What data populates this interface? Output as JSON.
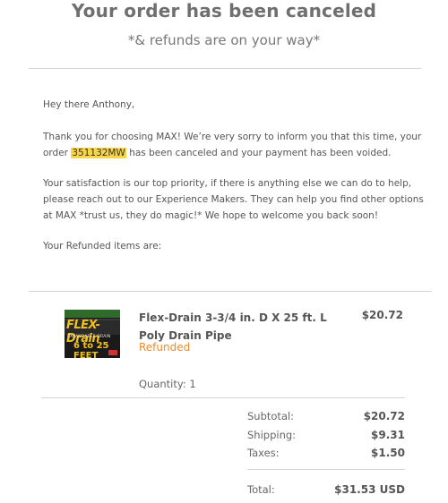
{
  "header": {
    "title": "Your order has been canceled",
    "subtitle": "*& refunds are on your way*"
  },
  "message": {
    "greeting": "Hey there Anthony,",
    "para1_before": "Thank you for choosing MAX! We’re very sorry to inform you that this time, your order ",
    "order_number": "351132MW",
    "para1_after": " has been canceled and your payment has been voided.",
    "para2": "Your satisfaction is our top priority, if there is anything else we can do to help, please reach out to our Experience Makers. They can help you find other options at MAX *trust us, they do magic!* We hope to welcome you back soon!",
    "refunded_intro": "Your Refunded items are:"
  },
  "item": {
    "image_brand_text": "FLEX-Drain",
    "image_sub_text": "EXPANDABLE DRAIN",
    "image_size_text": "6 to 25 FEET",
    "name": "Flex-Drain 3-3/4 in. D X 25 ft. L Poly Drain Pipe",
    "status": "Refunded",
    "price": "$20.72",
    "quantity": "Quantity: 1"
  },
  "summary": {
    "subtotal_label": "Subtotal:",
    "subtotal_value": "$20.72",
    "shipping_label": "Shipping:",
    "shipping_value": "$9.31",
    "taxes_label": "Taxes:",
    "taxes_value": "$1.50",
    "total_label": "Total:",
    "total_value": "$31.53 USD"
  },
  "colors": {
    "highlight": "#f7d64a",
    "refunded_status": "#f08a2a",
    "divider": "#d4d4d4"
  }
}
